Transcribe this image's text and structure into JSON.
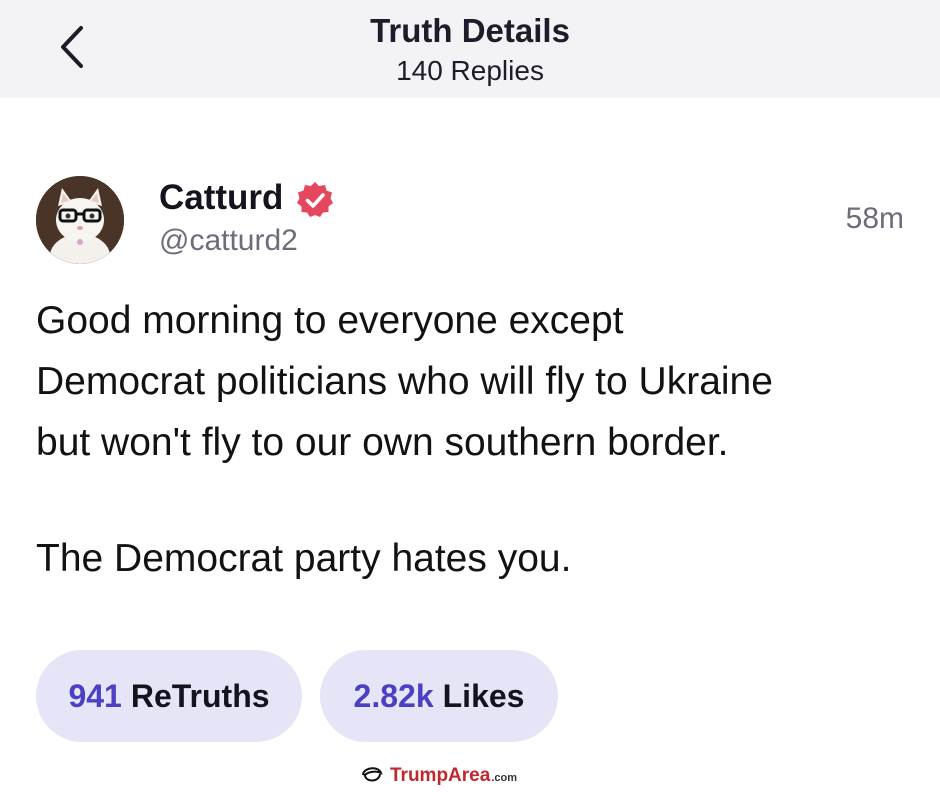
{
  "header": {
    "title": "Truth Details",
    "subtitle": "140 Replies",
    "back_icon": "chevron-left-icon"
  },
  "post": {
    "author_name": "Catturd",
    "handle": "@catturd2",
    "timestamp": "58m",
    "verified_icon": "verified-badge-icon",
    "verified_color": "#e4475e",
    "body_lines": [
      "Good morning to everyone except",
      "Democrat politicians who will fly to Ukraine",
      "but won't fly to our own southern border.",
      "The Democrat party hates you."
    ]
  },
  "stats": {
    "retruths_count": "941",
    "retruths_label": "ReTruths",
    "likes_count": "2.82k",
    "likes_label": "Likes",
    "accent_color": "#4b3fc4",
    "pill_bg": "#e6e4f7"
  },
  "watermark": {
    "brand": "TrumpArea",
    "suffix": ".com",
    "icon": "hair-logo-icon"
  }
}
